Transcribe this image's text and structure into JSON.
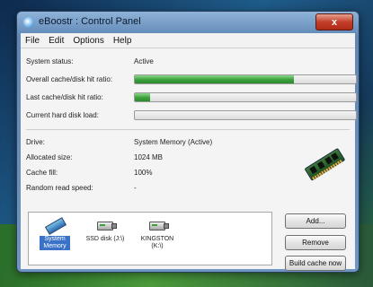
{
  "window": {
    "title": "eBoostr : Control Panel",
    "close_glyph": "x"
  },
  "menu": [
    "File",
    "Edit",
    "Options",
    "Help"
  ],
  "status": {
    "system_status_label": "System status:",
    "system_status_value": "Active",
    "overall_hit_label": "Overall cache/disk hit ratio:",
    "overall_hit_fraction": 0.72,
    "last_hit_label": "Last cache/disk hit ratio:",
    "last_hit_fraction": 0.07,
    "hd_load_label": "Current hard disk load:",
    "hd_load_fraction": 0.0
  },
  "drive_info": {
    "drive_label": "Drive:",
    "drive_value": "System Memory (Active)",
    "allocated_label": "Allocated size:",
    "allocated_value": "1024 MB",
    "fill_label": "Cache fill:",
    "fill_value": "100%",
    "random_label": "Random read speed:",
    "random_value": "-"
  },
  "drives": [
    {
      "label": "System Memory",
      "line1": "System",
      "line2": "Memory",
      "icon": "ram-icon",
      "selected": true
    },
    {
      "label": "SSD disk (J:\\)",
      "line1": "SSD disk (J:\\)",
      "line2": "",
      "icon": "usb-drive-icon",
      "selected": false
    },
    {
      "label": "KINGSTON (K:\\)",
      "line1": "KINGSTON",
      "line2": "(K:\\)",
      "icon": "usb-drive-icon",
      "selected": false
    }
  ],
  "buttons": {
    "add": "Add...",
    "remove": "Remove",
    "build": "Build cache now"
  },
  "colors": {
    "progress_green": "#3aa03a",
    "selection_blue": "#3a72c8"
  }
}
